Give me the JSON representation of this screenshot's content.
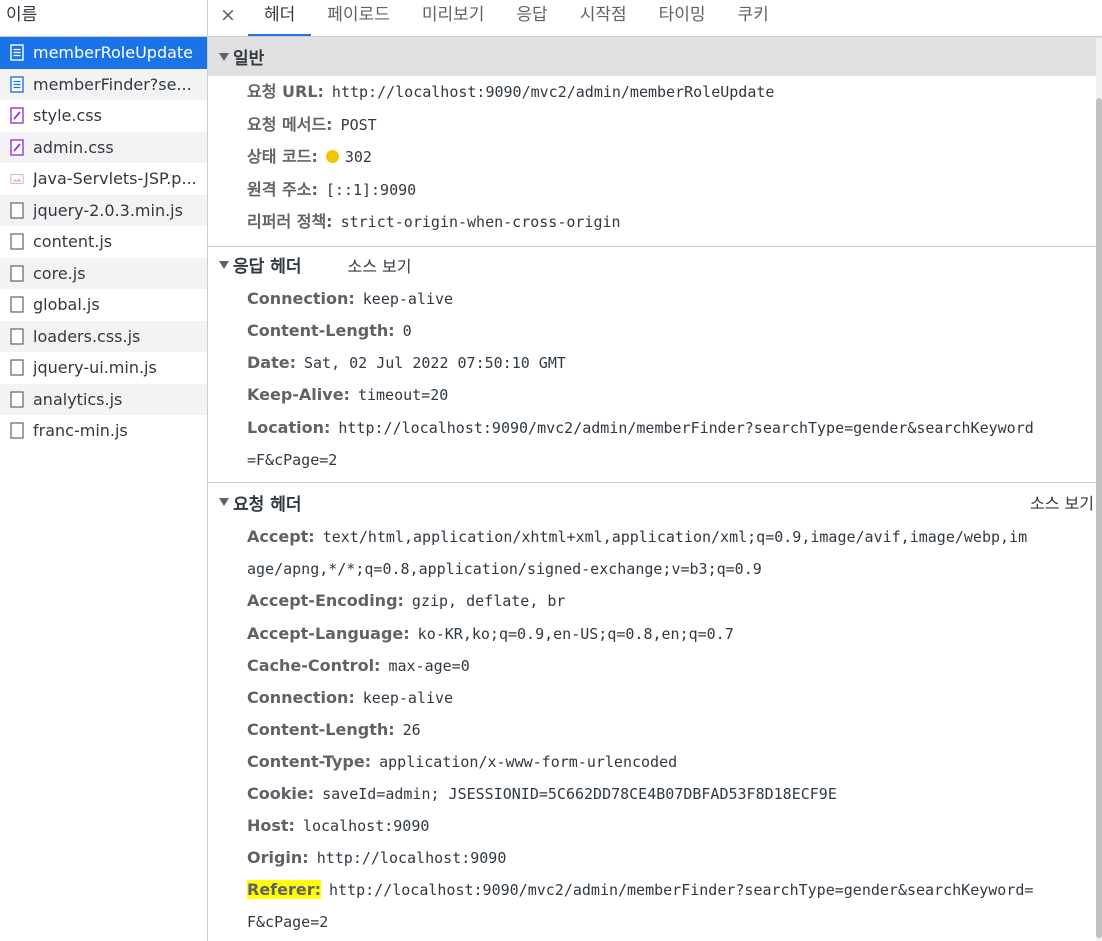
{
  "sidebar": {
    "header": "이름",
    "files": [
      {
        "name": "memberRoleUpdate",
        "icon": "document-icon",
        "selected": true
      },
      {
        "name": "memberFinder?se...",
        "icon": "document-icon"
      },
      {
        "name": "style.css",
        "icon": "stylesheet-icon"
      },
      {
        "name": "admin.css",
        "icon": "stylesheet-icon"
      },
      {
        "name": "Java-Servlets-JSP.p...",
        "icon": "image-icon"
      },
      {
        "name": "jquery-2.0.3.min.js",
        "icon": "script-icon"
      },
      {
        "name": "content.js",
        "icon": "script-icon"
      },
      {
        "name": "core.js",
        "icon": "script-icon"
      },
      {
        "name": "global.js",
        "icon": "script-icon"
      },
      {
        "name": "loaders.css.js",
        "icon": "script-icon"
      },
      {
        "name": "jquery-ui.min.js",
        "icon": "script-icon"
      },
      {
        "name": "analytics.js",
        "icon": "script-icon"
      },
      {
        "name": "franc-min.js",
        "icon": "script-icon"
      }
    ]
  },
  "tabs": {
    "close": "×",
    "items": [
      "헤더",
      "페이로드",
      "미리보기",
      "응답",
      "시작점",
      "타이밍",
      "쿠키"
    ],
    "active": "헤더"
  },
  "general": {
    "title": "일반",
    "rows": [
      {
        "key": "요청 URL:",
        "value": "http://localhost:9090/mvc2/admin/memberRoleUpdate"
      },
      {
        "key": "요청 메서드:",
        "value": "POST"
      },
      {
        "key": "상태 코드:",
        "value": "302",
        "status_color": "#f5c400"
      },
      {
        "key": "원격 주소:",
        "value": "[::1]:9090"
      },
      {
        "key": "리퍼러 정책:",
        "value": "strict-origin-when-cross-origin"
      }
    ]
  },
  "response_headers": {
    "title": "응답 헤더",
    "view_source": "소스 보기",
    "rows": [
      {
        "key": "Connection:",
        "value": "keep-alive"
      },
      {
        "key": "Content-Length:",
        "value": "0"
      },
      {
        "key": "Date:",
        "value": "Sat, 02 Jul 2022 07:50:10 GMT"
      },
      {
        "key": "Keep-Alive:",
        "value": "timeout=20"
      },
      {
        "key": "Location:",
        "value": "http://localhost:9090/mvc2/admin/memberFinder?searchType=gender&searchKeyword",
        "cont": "=F&cPage=2"
      }
    ]
  },
  "request_headers": {
    "title": "요청 헤더",
    "view_source": "소스 보기",
    "rows": [
      {
        "key": "Accept:",
        "value": "text/html,application/xhtml+xml,application/xml;q=0.9,image/avif,image/webp,im",
        "cont": "age/apng,*/*;q=0.8,application/signed-exchange;v=b3;q=0.9"
      },
      {
        "key": "Accept-Encoding:",
        "value": "gzip, deflate, br"
      },
      {
        "key": "Accept-Language:",
        "value": "ko-KR,ko;q=0.9,en-US;q=0.8,en;q=0.7"
      },
      {
        "key": "Cache-Control:",
        "value": "max-age=0"
      },
      {
        "key": "Connection:",
        "value": "keep-alive"
      },
      {
        "key": "Content-Length:",
        "value": "26"
      },
      {
        "key": "Content-Type:",
        "value": "application/x-www-form-urlencoded"
      },
      {
        "key": "Cookie:",
        "value": "saveId=admin; JSESSIONID=5C662DD78CE4B07DBFAD53F8D18ECF9E"
      },
      {
        "key": "Host:",
        "value": "localhost:9090"
      },
      {
        "key": "Origin:",
        "value": "http://localhost:9090"
      },
      {
        "key": "Referer:",
        "value": "http://localhost:9090/mvc2/admin/memberFinder?searchType=gender&searchKeyword=",
        "cont": "F&cPage=2",
        "highlight": true
      }
    ]
  },
  "colors": {
    "accent": "#1a73e8",
    "highlight": "#ffff00"
  }
}
